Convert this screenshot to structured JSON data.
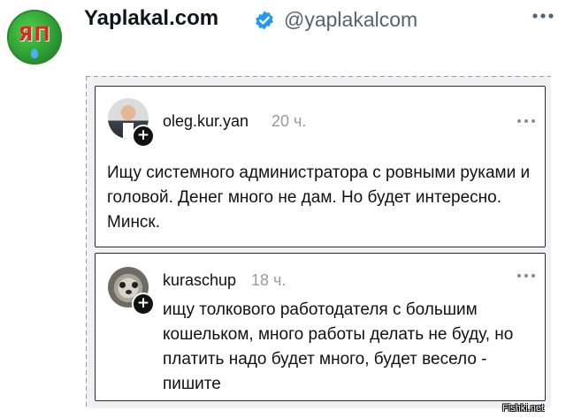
{
  "header": {
    "account_name": "Yaplakal.com",
    "handle": "@yaplakalcom",
    "avatar_logo_text": "ЯП",
    "verified": true,
    "icons": [
      "verified-badge-icon",
      "more-horizontal-icon"
    ],
    "colors": {
      "verified_blue": "#1d9bf0",
      "handle_gray": "#536471",
      "logo_red": "#d82b1f",
      "logo_green": "#2e9d33"
    }
  },
  "embedded_posts": [
    {
      "username": "oleg.kur.yan",
      "time": "20 ч.",
      "follow_symbol": "+",
      "text": "Ищу системного администратора с ровными руками и головой. Денег много не дам. Но будет интересно. Минск."
    },
    {
      "username": "kuraschup",
      "time": "18 ч.",
      "follow_symbol": "+",
      "text": "ищу толкового работодателя с большим кошельком, много работы делать не буду, но платить надо будет много, будет весело - пишите"
    }
  ],
  "watermark": "Fishki.net"
}
